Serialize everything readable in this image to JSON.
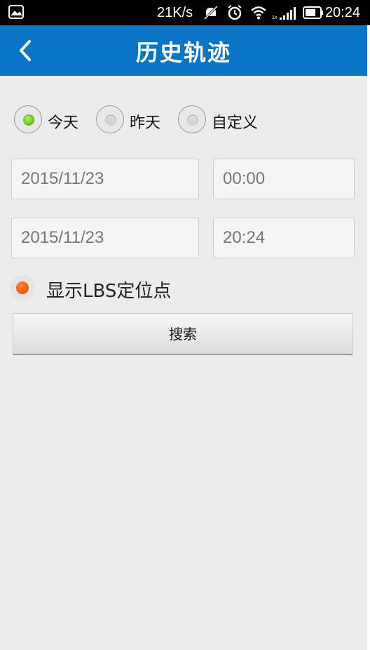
{
  "status_bar": {
    "net_speed": "21K/s",
    "time": "20:24",
    "icons": [
      "notification-image-icon",
      "mute-icon",
      "alarm-icon",
      "wifi-icon",
      "signal-icon",
      "battery-icon"
    ]
  },
  "header": {
    "title": "历史轨迹",
    "back_icon": "chevron-left-icon",
    "background": "#0a74c5"
  },
  "date_range_options": [
    {
      "label": "今天",
      "selected": true
    },
    {
      "label": "昨天",
      "selected": false
    },
    {
      "label": "自定义",
      "selected": false
    }
  ],
  "start": {
    "date": "2015/11/23",
    "time": "00:00"
  },
  "end": {
    "date": "2015/11/23",
    "time": "20:24"
  },
  "lbs_toggle": {
    "label": "显示LBS定位点",
    "checked": true,
    "color": "#e55a0a"
  },
  "search_button": {
    "label": "搜索"
  }
}
